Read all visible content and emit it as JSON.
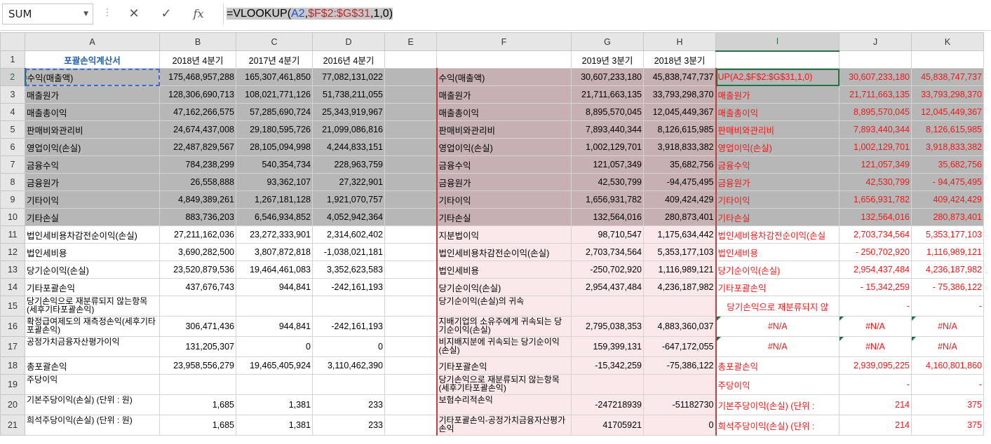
{
  "formula_bar": {
    "name_box": "SUM",
    "cancel_glyph": "✕",
    "enter_glyph": "✓",
    "fx_label": "fx",
    "formula_parts": {
      "prefix": "=VLOOKUP(",
      "ref1": "A2",
      "comma1": ",",
      "ref2": "$F$2:$G$31",
      "suffix": ",1,0)"
    }
  },
  "columns": [
    "A",
    "B",
    "C",
    "D",
    "E",
    "F",
    "G",
    "H",
    "I",
    "J",
    "K"
  ],
  "rows": [
    {
      "n": "1",
      "A": "포괄손익계산서",
      "B": "2018년 4분기",
      "C": "2017년 4분기",
      "D": "2016년 4분기",
      "E": "",
      "F": "",
      "G": "2019년 3분기",
      "H": "2018년 3분기",
      "I": "",
      "J": "",
      "K": ""
    },
    {
      "n": "2",
      "A": "수익(매출액)",
      "B": "175,468,957,288",
      "C": "165,307,461,850",
      "D": "77,082,131,022",
      "E": "",
      "F": "수익(매출액)",
      "G": "30,607,233,180",
      "H": "45,838,747,737",
      "I": "UP(A2,$F$2:$G$31,1,0)",
      "J": "30,607,233,180",
      "K": "45,838,747,737"
    },
    {
      "n": "3",
      "A": "매출원가",
      "B": "128,306,690,713",
      "C": "108,021,771,126",
      "D": "51,738,211,055",
      "E": "",
      "F": "매출원가",
      "G": "21,711,663,135",
      "H": "33,793,298,370",
      "I": "매출원가",
      "J": "21,711,663,135",
      "K": "33,793,298,370"
    },
    {
      "n": "4",
      "A": "매출총이익",
      "B": "47,162,266,575",
      "C": "57,285,690,724",
      "D": "25,343,919,967",
      "E": "",
      "F": "매출총이익",
      "G": "8,895,570,045",
      "H": "12,045,449,367",
      "I": "매출총이익",
      "J": "8,895,570,045",
      "K": "12,045,449,367"
    },
    {
      "n": "5",
      "A": "판매비와관리비",
      "B": "24,674,437,008",
      "C": "29,180,595,726",
      "D": "21,099,086,816",
      "E": "",
      "F": "판매비와관리비",
      "G": "7,893,440,344",
      "H": "8,126,615,985",
      "I": "판매비와관리비",
      "J": "7,893,440,344",
      "K": "8,126,615,985"
    },
    {
      "n": "6",
      "A": "영업이익(손실)",
      "B": "22,487,829,567",
      "C": "28,105,094,998",
      "D": "4,244,833,151",
      "E": "",
      "F": "영업이익(손실)",
      "G": "1,002,129,701",
      "H": "3,918,833,382",
      "I": "영업이익(손실)",
      "J": "1,002,129,701",
      "K": "3,918,833,382"
    },
    {
      "n": "7",
      "A": "금융수익",
      "B": "784,238,299",
      "C": "540,354,734",
      "D": "228,963,759",
      "E": "",
      "F": "금융수익",
      "G": "121,057,349",
      "H": "35,682,756",
      "I": "금융수익",
      "J": "121,057,349",
      "K": "35,682,756"
    },
    {
      "n": "8",
      "A": "금융원가",
      "B": "26,558,888",
      "C": "93,362,107",
      "D": "27,322,901",
      "E": "",
      "F": "금융원가",
      "G": "42,530,799",
      "H": "-94,475,495",
      "I": "금융원가",
      "J": "42,530,799",
      "K": "-   94,475,495"
    },
    {
      "n": "9",
      "A": "기타이익",
      "B": "4,849,389,261",
      "C": "1,267,181,128",
      "D": "1,921,070,757",
      "E": "",
      "F": "기타이익",
      "G": "1,656,931,782",
      "H": "409,424,429",
      "I": "기타이익",
      "J": "1,656,931,782",
      "K": "409,424,429"
    },
    {
      "n": "10",
      "A": "기타손실",
      "B": "883,736,203",
      "C": "6,546,934,852",
      "D": "4,052,942,364",
      "E": "",
      "F": "기타손실",
      "G": "132,564,016",
      "H": "280,873,401",
      "I": "기타손실",
      "J": "132,564,016",
      "K": "280,873,401"
    },
    {
      "n": "11",
      "A": "법인세비용차감전순이익(손실)",
      "B": "27,211,162,036",
      "C": "23,272,333,901",
      "D": "2,314,602,402",
      "E": "",
      "F": "지분법이익",
      "G": "98,710,547",
      "H": "1,175,634,442",
      "I": "법인세비용차감전순이익(손실",
      "J": "2,703,734,564",
      "K": "5,353,177,103"
    },
    {
      "n": "12",
      "A": "법인세비용",
      "B": "3,690,282,500",
      "C": "3,807,872,818",
      "D": "-1,038,021,181",
      "E": "",
      "F": "법인세비용차감전순이익(손실)",
      "G": "2,703,734,564",
      "H": "5,353,177,103",
      "I": "법인세비용",
      "J": "-   250,702,920",
      "K": "1,116,989,121"
    },
    {
      "n": "13",
      "A": "당기순이익(손실)",
      "B": "23,520,879,536",
      "C": "19,464,461,083",
      "D": "3,352,623,583",
      "E": "",
      "F": "법인세비용",
      "G": "-250,702,920",
      "H": "1,116,989,121",
      "I": "당기순이익(손실)",
      "J": "2,954,437,484",
      "K": "4,236,187,982"
    },
    {
      "n": "14",
      "A": "기타포괄손익",
      "B": "437,676,743",
      "C": "944,841",
      "D": "-242,161,193",
      "E": "",
      "F": "당기순이익(손실)",
      "G": "2,954,437,484",
      "H": "4,236,187,982",
      "I": "기타포괄손익",
      "J": "-    15,342,259",
      "K": "-    75,386,122"
    },
    {
      "n": "15",
      "A": "    당기손익으로 재분류되지 않는항목(세후기타포괄손익)",
      "B": "",
      "C": "",
      "D": "",
      "E": "",
      "F": "당기순이익(손실)의 귀속",
      "G": "",
      "H": "",
      "I": "   당기손익으로 재분류되지 않",
      "J": "-",
      "K": "-"
    },
    {
      "n": "16",
      "A": "      확정급여제도의 재측정손익(세후기타포괄손익)",
      "B": "306,471,436",
      "C": "944,841",
      "D": "-242,161,193",
      "E": "",
      "F": "   지배기업의 소유주에게 귀속되는 당기순이익(손실)",
      "G": "2,795,038,353",
      "H": "4,883,360,037",
      "I": "#N/A",
      "J": "#N/A",
      "K": "#N/A"
    },
    {
      "n": "17",
      "A": "      공정가치금융자산평가이익",
      "B": "131,205,307",
      "C": "0",
      "D": "0",
      "E": "",
      "F": "   비지배지분에 귀속되는 당기순이익(손실)",
      "G": "159,399,131",
      "H": "-647,172,055",
      "I": "#N/A",
      "J": "#N/A",
      "K": "#N/A"
    },
    {
      "n": "18",
      "A": "총포괄손익",
      "B": "23,958,556,279",
      "C": "19,465,405,924",
      "D": "3,110,462,390",
      "E": "",
      "F": "기타포괄손익",
      "G": "-15,342,259",
      "H": "-75,386,122",
      "I": "총포괄손익",
      "J": "2,939,095,225",
      "K": "4,160,801,860"
    },
    {
      "n": "19",
      "A": "주당이익",
      "B": "",
      "C": "",
      "D": "",
      "E": "",
      "F": "   당기손익으로 재분류되지 않는항목(세후기타포괄손익)",
      "G": "",
      "H": "",
      "I": "주당이익",
      "J": "-",
      "K": "-"
    },
    {
      "n": "20",
      "A": "   기본주당이익(손실) (단위 : 원)",
      "B": "1,685",
      "C": "1,381",
      "D": "233",
      "E": "",
      "F": "      보험수리적손익",
      "G": "-247218939",
      "H": "-51182730",
      "I": "   기본주당이익(손실) (단위 :",
      "J": "214",
      "K": "375"
    },
    {
      "n": "21",
      "A": "   희석주당이익(손실) (단위 : 원)",
      "B": "1,685",
      "C": "1,381",
      "D": "233",
      "E": "",
      "F": "      기타포괄손익-공정가치금융자산평가손익",
      "G": "41705921",
      "H": "0",
      "I": "   희석주당이익(손실) (단위 :",
      "J": "214",
      "K": "375"
    }
  ]
}
